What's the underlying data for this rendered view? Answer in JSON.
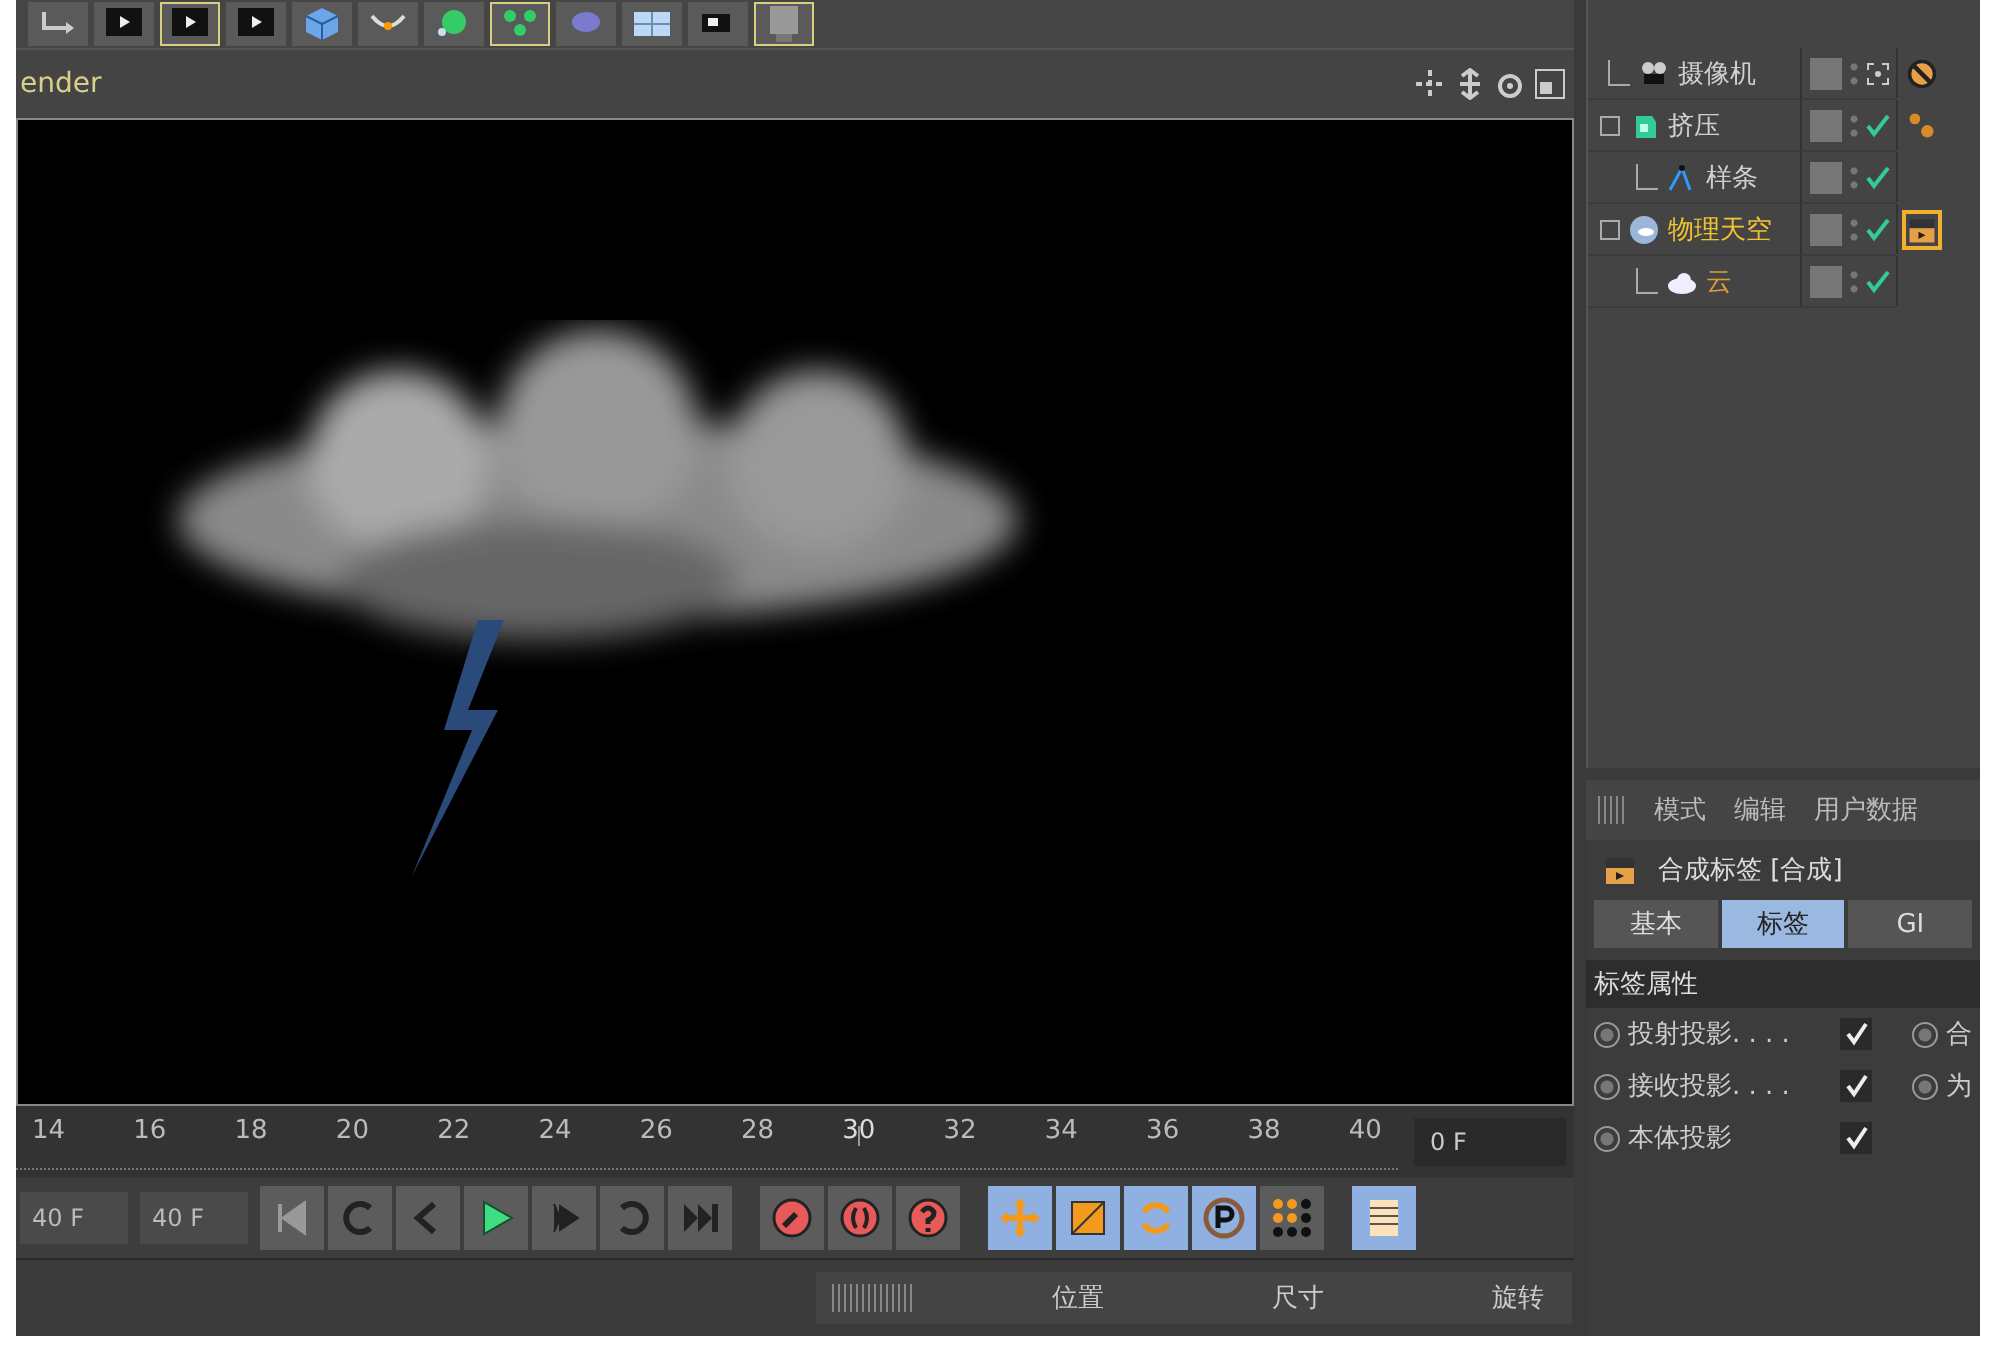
{
  "toolbar": [
    {
      "kind": "undo",
      "selected": false
    },
    {
      "kind": "render",
      "selected": false
    },
    {
      "kind": "render",
      "selected": true
    },
    {
      "kind": "render",
      "selected": false
    },
    {
      "kind": "cube",
      "selected": false
    },
    {
      "kind": "bend",
      "selected": false
    },
    {
      "kind": "nurbs",
      "selected": false
    },
    {
      "kind": "array",
      "selected": true
    },
    {
      "kind": "deformer",
      "selected": false
    },
    {
      "kind": "floor",
      "selected": false
    },
    {
      "kind": "camera",
      "selected": false
    },
    {
      "kind": "light",
      "selected": true
    }
  ],
  "viewport": {
    "title": "ender"
  },
  "objects": [
    {
      "name": "摄像机",
      "kind": "camera",
      "color": "#cfcfcf",
      "tags": [
        {
          "kind": "protection",
          "selected": false
        }
      ]
    },
    {
      "name": "挤压",
      "kind": "extrude",
      "color": "#cfcfcf",
      "tags": [
        {
          "kind": "dots",
          "selected": false
        }
      ],
      "children": [
        {
          "name": "样条",
          "kind": "spline",
          "color": "#cfcfcf"
        }
      ]
    },
    {
      "name": "物理天空",
      "kind": "sky",
      "color": "#f2c230",
      "tags": [
        {
          "kind": "clapper",
          "selected": true
        }
      ],
      "children": [
        {
          "name": "云",
          "kind": "cloud",
          "color": "#e09a3a"
        }
      ]
    }
  ],
  "attributes": {
    "menu": [
      "模式",
      "编辑",
      "用户数据"
    ],
    "title": "合成标签 [合成]",
    "tabs": [
      {
        "label": "基本",
        "selected": false
      },
      {
        "label": "标签",
        "selected": true
      },
      {
        "label": "GI",
        "selected": false
      }
    ],
    "section": "标签属性",
    "options": [
      {
        "label": "投射投影. . . .",
        "checked": true,
        "second": "合"
      },
      {
        "label": "接收投影. . . .",
        "checked": true,
        "second": "为"
      },
      {
        "label": "本体投影",
        "checked": true
      }
    ]
  },
  "timeline": {
    "ticks": [
      {
        "label": "14",
        "current": false
      },
      {
        "label": "16",
        "current": false
      },
      {
        "label": "18",
        "current": false
      },
      {
        "label": "20",
        "current": false
      },
      {
        "label": "22",
        "current": false
      },
      {
        "label": "24",
        "current": false
      },
      {
        "label": "26",
        "current": false
      },
      {
        "label": "28",
        "current": false
      },
      {
        "label": "30",
        "current": true
      },
      {
        "label": "32",
        "current": false
      },
      {
        "label": "34",
        "current": false
      },
      {
        "label": "36",
        "current": false
      },
      {
        "label": "38",
        "current": false
      },
      {
        "label": "40",
        "current": false
      }
    ],
    "frame": "0 F"
  },
  "transport": {
    "fields": [
      "40 F",
      "40 F"
    ],
    "buttons": [
      {
        "kind": "first"
      },
      {
        "kind": "loop-back"
      },
      {
        "kind": "prev"
      },
      {
        "kind": "play"
      },
      {
        "kind": "next"
      },
      {
        "kind": "loop"
      },
      {
        "kind": "last"
      },
      {
        "kind": "key"
      },
      {
        "kind": "autokey"
      },
      {
        "kind": "help"
      },
      {
        "kind": "move",
        "selected": true
      },
      {
        "kind": "scale",
        "selected": true
      },
      {
        "kind": "rotate",
        "selected": true
      },
      {
        "kind": "param",
        "selected": true
      },
      {
        "kind": "grid",
        "selected": false
      },
      {
        "kind": "film",
        "selected": true
      }
    ]
  },
  "coordinates": [
    "位置",
    "尺寸",
    "旋转"
  ]
}
